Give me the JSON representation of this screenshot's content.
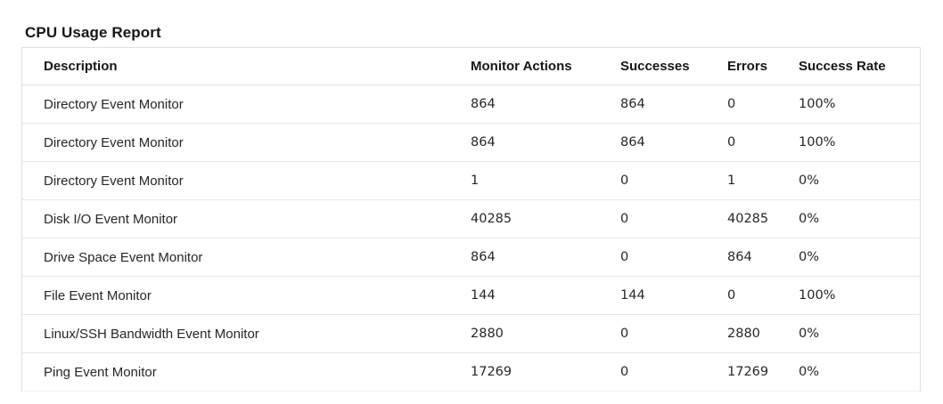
{
  "report": {
    "title": "CPU Usage Report"
  },
  "table": {
    "headers": {
      "description": "Description",
      "monitor_actions": "Monitor Actions",
      "successes": "Successes",
      "errors": "Errors",
      "success_rate": "Success Rate"
    },
    "rows": [
      {
        "description": "Directory Event Monitor",
        "monitor_actions": "864",
        "successes": "864",
        "errors": "0",
        "success_rate": "100%"
      },
      {
        "description": "Directory Event Monitor",
        "monitor_actions": "864",
        "successes": "864",
        "errors": "0",
        "success_rate": "100%"
      },
      {
        "description": "Directory Event Monitor",
        "monitor_actions": "1",
        "successes": "0",
        "errors": "1",
        "success_rate": "0%"
      },
      {
        "description": "Disk I/O Event Monitor",
        "monitor_actions": "40285",
        "successes": "0",
        "errors": "40285",
        "success_rate": "0%"
      },
      {
        "description": "Drive Space Event Monitor",
        "monitor_actions": "864",
        "successes": "0",
        "errors": "864",
        "success_rate": "0%"
      },
      {
        "description": "File Event Monitor",
        "monitor_actions": "144",
        "successes": "144",
        "errors": "0",
        "success_rate": "100%"
      },
      {
        "description": "Linux/SSH Bandwidth Event Monitor",
        "monitor_actions": "2880",
        "successes": "0",
        "errors": "2880",
        "success_rate": "0%"
      },
      {
        "description": "Ping Event Monitor",
        "monitor_actions": "17269",
        "successes": "0",
        "errors": "17269",
        "success_rate": "0%"
      }
    ]
  }
}
